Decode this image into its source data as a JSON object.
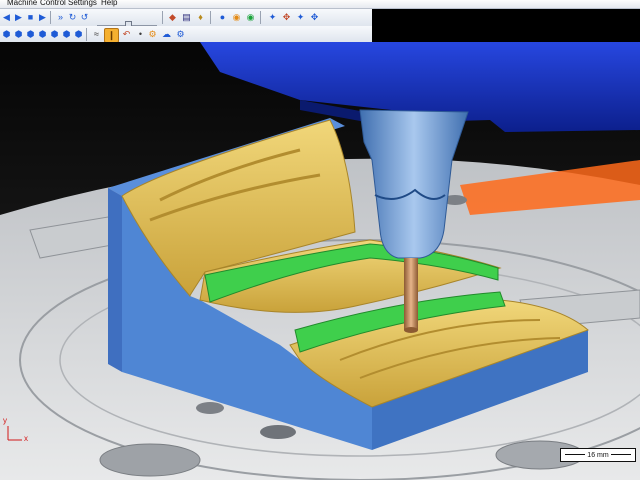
{
  "menu": {
    "items": [
      "Machine",
      "Control",
      "Settings",
      "Help"
    ]
  },
  "toolbar_top": {
    "icons": [
      "step-back-icon",
      "step-forward-icon",
      "stop-icon",
      "play-icon",
      "fast-forward-icon",
      "loop-icon",
      "rewind-icon",
      "cube-icon",
      "speed-slider",
      "tool-select-icon",
      "grid-icon",
      "stock-icon",
      "shade-icon",
      "view-orange-icon",
      "view-green-icon",
      "zoom-fit-icon",
      "zoom-window-icon",
      "zoom-in-icon",
      "zoom-out-icon"
    ]
  },
  "toolbar_bottom": {
    "icons": [
      "view-iso-icon",
      "view-top-icon",
      "view-front-icon",
      "view-side-icon",
      "view-back-icon",
      "view-bottom-icon",
      "view-left-icon",
      "tool-path-icon",
      "tool-path-active-icon",
      "measure-icon",
      "machine-tool-icon",
      "undo-icon",
      "stock-color-icon",
      "settings-icon"
    ]
  },
  "scale": {
    "label": "16 mm"
  },
  "axes": {
    "x_label": "x",
    "y_label": "y"
  },
  "colors": {
    "machine_head": "#1631c4",
    "stock_sides": "#4f86d4",
    "machined_surface": "#e3c45c",
    "green_band": "#3fcf4c",
    "table": "#d6d8da",
    "tool_body": "#6d9ed6",
    "tool_bit": "#c98b5a"
  }
}
